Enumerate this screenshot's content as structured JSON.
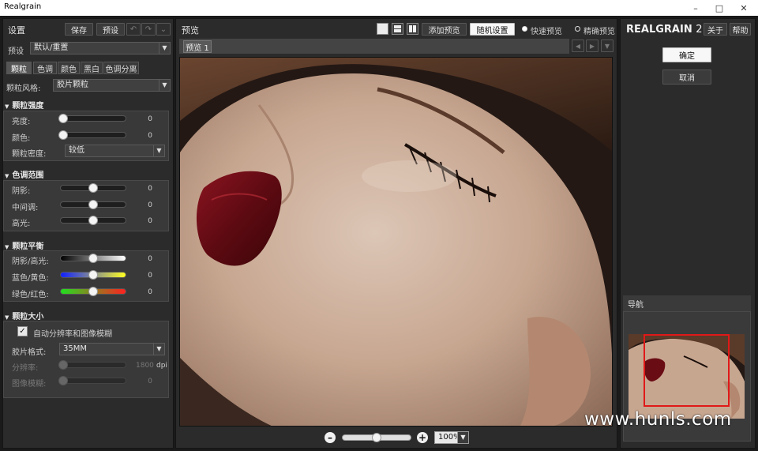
{
  "window": {
    "title": "Realgrain",
    "controls": [
      "minimize-icon",
      "maximize-icon",
      "close-icon"
    ]
  },
  "left": {
    "title": "设置",
    "save_label": "保存",
    "preset_btn_label": "预设",
    "preset_label": "预设",
    "preset_value": "默认/重置",
    "tabs": [
      "颗粒",
      "色调",
      "颜色",
      "黑白",
      "色调分离"
    ],
    "grain_style_label": "颗粒风格:",
    "grain_style_value": "胶片颗粒",
    "sections": {
      "strength": {
        "title": "颗粒强度",
        "brightness_label": "亮度:",
        "brightness_value": "0",
        "color_label": "颜色:",
        "color_value": "0",
        "density_label": "颗粒密度:",
        "density_value": "较低"
      },
      "tonal": {
        "title": "色调范围",
        "shadow_label": "阴影:",
        "shadow_value": "0",
        "mid_label": "中间调:",
        "mid_value": "0",
        "highlight_label": "高光:",
        "highlight_value": "0"
      },
      "balance": {
        "title": "颗粒平衡",
        "sh_label": "阴影/高光:",
        "sh_value": "0",
        "by_label": "蓝色/黄色:",
        "by_value": "0",
        "gr_label": "绿色/红色:",
        "gr_value": "0"
      },
      "size": {
        "title": "颗粒大小",
        "auto_label": "自动分辨率和图像模糊",
        "film_format_label": "胶片格式:",
        "film_format_value": "35MM",
        "resolution_label": "分辨率:",
        "resolution_value": "1800",
        "resolution_unit": "dpi",
        "blur_label": "图像模糊:",
        "blur_value": "0"
      }
    }
  },
  "center": {
    "title": "预览",
    "add_preview_label": "添加预览",
    "random_settings_label": "随机设置",
    "fast_preview_label": "快速预览",
    "accurate_preview_label": "精确预览",
    "preview_tab": "预览 1",
    "zoom_value": "100%"
  },
  "right": {
    "logo_main": "REALGRAIN",
    "logo_num": "2",
    "about_label": "关于",
    "help_label": "帮助",
    "ok_label": "确定",
    "cancel_label": "取消",
    "navigator_title": "导航"
  },
  "watermark": "www.hunls.com",
  "colors": {
    "panel_bg": "#2b2b2b",
    "section_bg": "#393939",
    "accent_red": "#e01818"
  }
}
